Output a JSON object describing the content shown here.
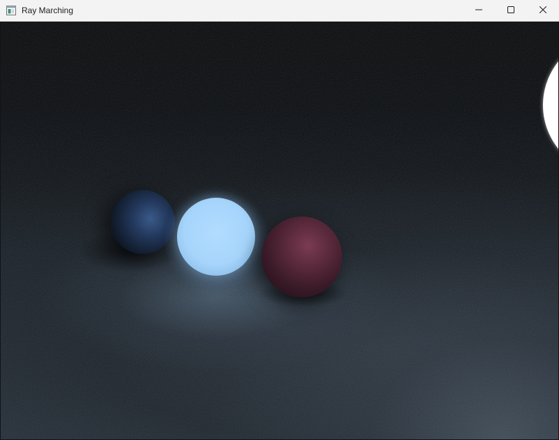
{
  "window": {
    "title": "Ray Marching",
    "icon": "app-window-icon",
    "controls": {
      "minimize_icon": "minimize-icon",
      "maximize_icon": "maximize-icon",
      "close_icon": "close-icon"
    }
  },
  "scene": {
    "background_top": "#040506",
    "floor_color": "#222c36",
    "spheres": [
      {
        "name": "blue-sphere",
        "color": "#2e4a78"
      },
      {
        "name": "glowing-sphere",
        "color": "#a6d4fb"
      },
      {
        "name": "red-sphere",
        "color": "#5b2a3d"
      },
      {
        "name": "white-light-sphere",
        "color": "#ffffff"
      }
    ]
  }
}
